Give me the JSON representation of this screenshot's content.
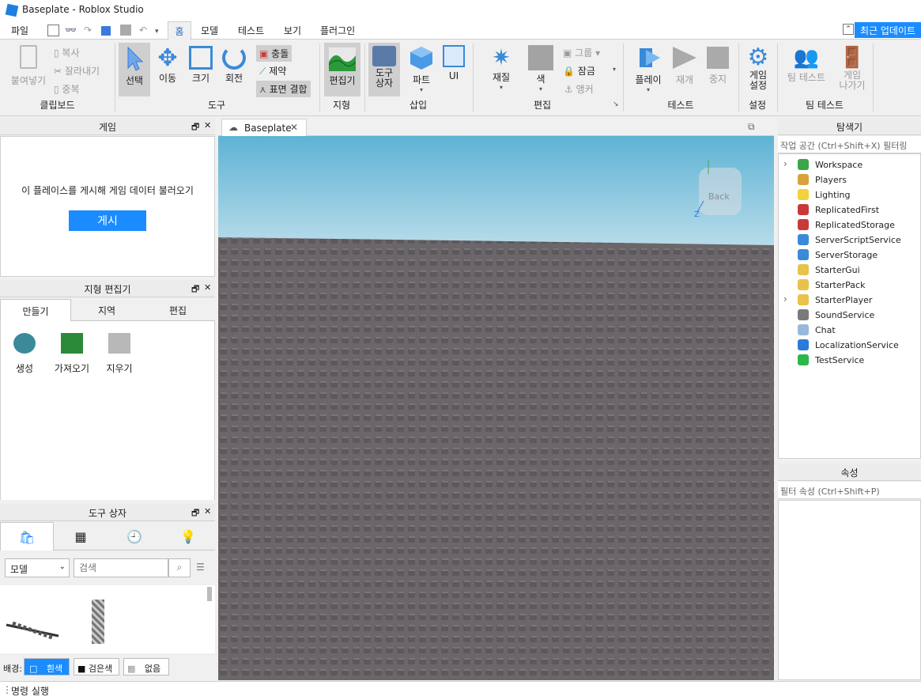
{
  "window": {
    "title": "Baseplate - Roblox Studio"
  },
  "menu": {
    "file": "파일",
    "tabs": [
      "홈",
      "모델",
      "테스트",
      "보기",
      "플러그인"
    ],
    "active_tab": "홈",
    "update_button": "최근 업데이트"
  },
  "ribbon": {
    "clipboard": {
      "paste": "붙여넣기",
      "copy": "복사",
      "cut": "잘라내기",
      "duplicate": "중복",
      "group": "클립보드"
    },
    "tools": {
      "select": "선택",
      "move": "이동",
      "scale": "크기",
      "rotate": "회전",
      "collisions": "충돌",
      "constraints": "제약",
      "join_surfaces": "표면 결합",
      "group": "도구"
    },
    "terrain": {
      "editor": "편집기",
      "group": "지형"
    },
    "insert": {
      "toolbox": "도구\n상자",
      "part": "파트",
      "ui": "UI",
      "group": "삽입"
    },
    "edit": {
      "material": "재질",
      "color": "색",
      "group_btn": "그룹",
      "lock": "잠금",
      "anchor": "앵커",
      "group": "편집"
    },
    "test": {
      "play": "플레이",
      "resume": "재개",
      "stop": "중지",
      "group": "테스트"
    },
    "settings": {
      "game_settings": "게임\n설정",
      "group": "설정"
    },
    "team_test": {
      "team_test": "팀 테스트",
      "exit_game": "게임\n나가기",
      "group": "팀 테스트"
    }
  },
  "game_panel": {
    "title": "게임",
    "message": "이 플레이스를 게시해 게임 데이터 불러오기",
    "publish": "게시"
  },
  "terrain_panel": {
    "title": "지형 편집기",
    "tabs": [
      "만들기",
      "지역",
      "편집"
    ],
    "items": [
      "생성",
      "가져오기",
      "지우기"
    ]
  },
  "toolbox_panel": {
    "title": "도구 상자",
    "category": "모델",
    "search_placeholder": "검색",
    "bg_label": "배경:",
    "bg_options": [
      "흰색",
      "검은색",
      "없음"
    ]
  },
  "viewport": {
    "tab": "Baseplate",
    "view_cube_label": "Back"
  },
  "explorer": {
    "title": "탐색기",
    "filter_placeholder": "작업 공간 (Ctrl+Shift+X) 필터링",
    "items": [
      {
        "name": "Workspace",
        "expandable": true,
        "color": "#3aa54a"
      },
      {
        "name": "Players",
        "expandable": false,
        "color": "#d9a23a"
      },
      {
        "name": "Lighting",
        "expandable": false,
        "color": "#f2d23a"
      },
      {
        "name": "ReplicatedFirst",
        "expandable": false,
        "color": "#c83a3a"
      },
      {
        "name": "ReplicatedStorage",
        "expandable": false,
        "color": "#c83a3a"
      },
      {
        "name": "ServerScriptService",
        "expandable": false,
        "color": "#3a8ad9"
      },
      {
        "name": "ServerStorage",
        "expandable": false,
        "color": "#3a8ad9"
      },
      {
        "name": "StarterGui",
        "expandable": false,
        "color": "#e8c24a"
      },
      {
        "name": "StarterPack",
        "expandable": false,
        "color": "#e8c24a"
      },
      {
        "name": "StarterPlayer",
        "expandable": true,
        "color": "#e8c24a"
      },
      {
        "name": "SoundService",
        "expandable": false,
        "color": "#7a7a7a"
      },
      {
        "name": "Chat",
        "expandable": false,
        "color": "#9ab8d9"
      },
      {
        "name": "LocalizationService",
        "expandable": false,
        "color": "#2a7ad9"
      },
      {
        "name": "TestService",
        "expandable": false,
        "color": "#2ab84a"
      }
    ]
  },
  "properties": {
    "title": "속성",
    "filter_placeholder": "필터 속성 (Ctrl+Shift+P)"
  },
  "command_bar": {
    "placeholder": "명령 실행"
  }
}
